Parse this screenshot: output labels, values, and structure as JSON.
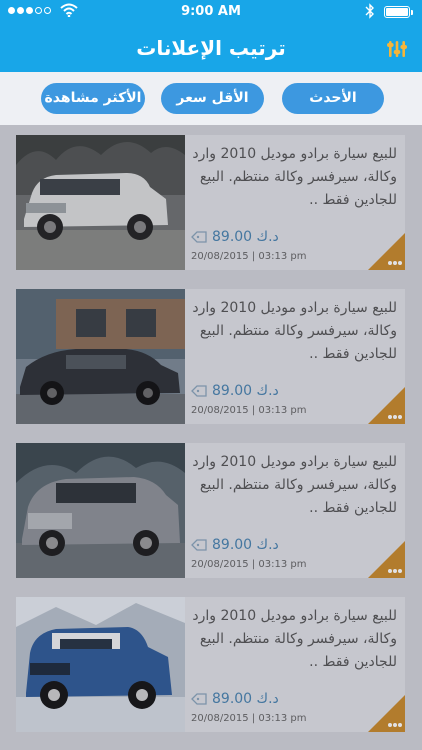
{
  "status_bar": {
    "time": "9:00 AM",
    "signal_bars": 5,
    "signal_filled": 3,
    "battery_level": 1.0
  },
  "header": {
    "title": "ترتيب الإعلانات",
    "filter_icon": "filter-sliders-icon"
  },
  "sort_options": [
    {
      "label": "الأحدث"
    },
    {
      "label": "الأقل سعر"
    },
    {
      "label": "الأكثر مشاهدة"
    }
  ],
  "colors": {
    "header": "#18a6e8",
    "pill": "#3d98e0",
    "corner": "#c98a2a",
    "price": "#4a84b0"
  },
  "listings": [
    {
      "description": "للبيع سيارة برادو موديل 2010 وارد وكالة، سيرفسر وكالة منتظم. البيع للجادين فقط ..",
      "price": "89.00",
      "currency": "د.ك",
      "date": "20/08/2015",
      "time": "03:13 pm",
      "image": "white-suv"
    },
    {
      "description": "للبيع سيارة برادو موديل 2010 وارد وكالة، سيرفسر وكالة منتظم. البيع للجادين فقط ..",
      "price": "89.00",
      "currency": "د.ك",
      "date": "20/08/2015",
      "time": "03:13 pm",
      "image": "dark-sedan"
    },
    {
      "description": "للبيع سيارة برادو موديل 2010 وارد وكالة، سيرفسر وكالة منتظم. البيع للجادين فقط ..",
      "price": "89.00",
      "currency": "د.ك",
      "date": "20/08/2015",
      "time": "03:13 pm",
      "image": "grey-suv"
    },
    {
      "description": "للبيع سيارة برادو موديل 2010 وارد وكالة، سيرفسر وكالة منتظم. البيع للجادين فقط ..",
      "price": "89.00",
      "currency": "د.ك",
      "date": "20/08/2015",
      "time": "03:13 pm",
      "image": "blue-fj-cruiser"
    }
  ]
}
